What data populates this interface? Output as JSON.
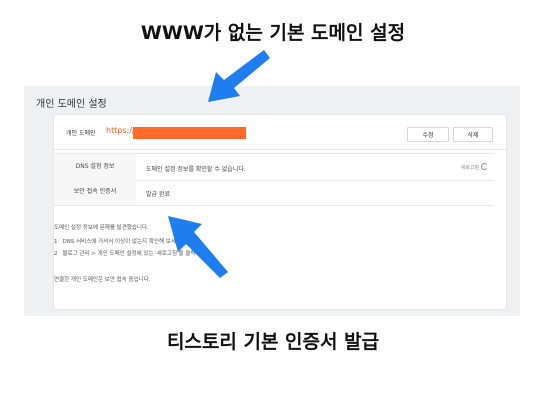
{
  "captions": {
    "top": "WWW가 없는 기본 도메인 설정",
    "bottom": "티스토리 기본 인증서 발급"
  },
  "panel": {
    "title": "개인 도메인 설정",
    "domain_label": "개인 도메인",
    "domain_url": "https://o",
    "edit_label": "수정",
    "delete_label": "삭제",
    "rows": [
      {
        "label": "DNS 설정 정보",
        "value": "도메인 설정 정보를 확인할 수 없습니다.",
        "action": "새로고침"
      },
      {
        "label": "보안 접속 인증서",
        "value": "발급 완료"
      }
    ],
    "notes": [
      "도메인 설정 정보에 문제를 발견했습니다.",
      "DNS 서비스에 가셔서 이상이 없는지 확인해 보세요.",
      "블로그 관리 > 개인 도메인 설정에 있는 '새로고침'을 클릭하세요.",
      "연결한 개인 도메인은 보안 접속 중입니다."
    ],
    "note_numbers": [
      "1",
      "2"
    ]
  },
  "colors": {
    "arrow": "#1e7ef0",
    "redaction": "#ff6a2a",
    "url": "#ff5a2b",
    "panel_bg": "#eef0f3"
  }
}
